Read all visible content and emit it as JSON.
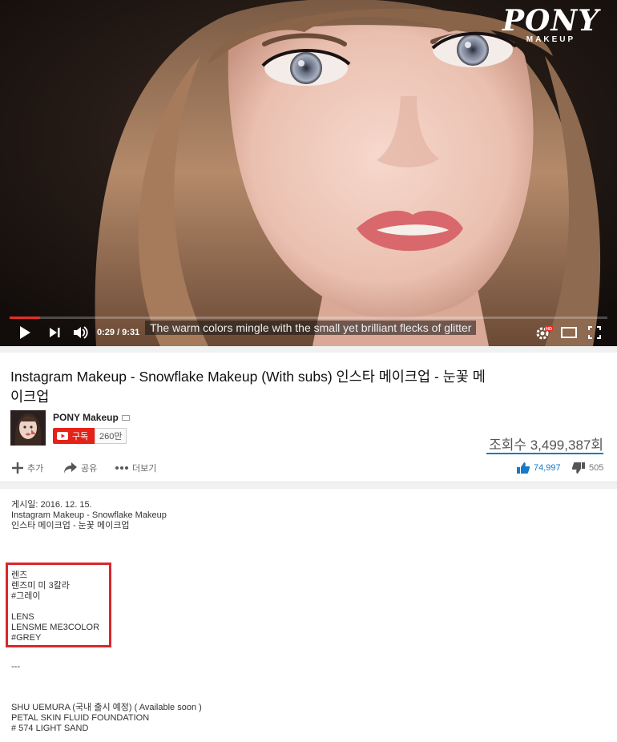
{
  "player": {
    "logo": {
      "title": "PONY",
      "subtitle": "MAKEUP"
    },
    "time": "0:29 / 9:31",
    "progress": 0.051,
    "subtitle": "The warm colors mingle with the small yet brilliant flecks of glitter",
    "icons": [
      "play-icon",
      "next-icon",
      "volume-icon",
      "settings-hd-icon",
      "theater-mode-icon",
      "fullscreen-icon"
    ]
  },
  "video": {
    "title": "Instagram Makeup - Snowflake Makeup (With subs) 인스타 메이크업 - 눈꽃 메이크업",
    "channel": "PONY Makeup",
    "subscribe_label": "구독",
    "subscriber_count": "260만",
    "views": "조회수 3,499,387회",
    "actions": {
      "add": "추가",
      "share": "공유",
      "more": "더보기"
    },
    "likes": "74,997",
    "dislikes": "505"
  },
  "description": {
    "published": "게시일: 2016. 12. 15.",
    "line1": "Instagram Makeup - Snowflake Makeup",
    "line2": "인스타 메이크업 - 눈꽃 메이크업",
    "lens_ko_1": "렌즈",
    "lens_ko_2": "렌즈미 미 3칼라",
    "lens_ko_3": "#그레이",
    "lens_en_1": "LENS",
    "lens_en_2": "LENSME ME3COLOR",
    "lens_en_3": "#GREY",
    "separator": "---",
    "product_1": "SHU UEMURA (국내 출시 예정) ( Available soon )",
    "product_2": "PETAL SKIN FLUID FOUNDATION",
    "product_3": "# 574 LIGHT SAND"
  },
  "colors": {
    "progress": "#e52d27",
    "subscribe": "#e62117",
    "highlight_box": "#d7282d",
    "link_blue": "#167ac6"
  }
}
